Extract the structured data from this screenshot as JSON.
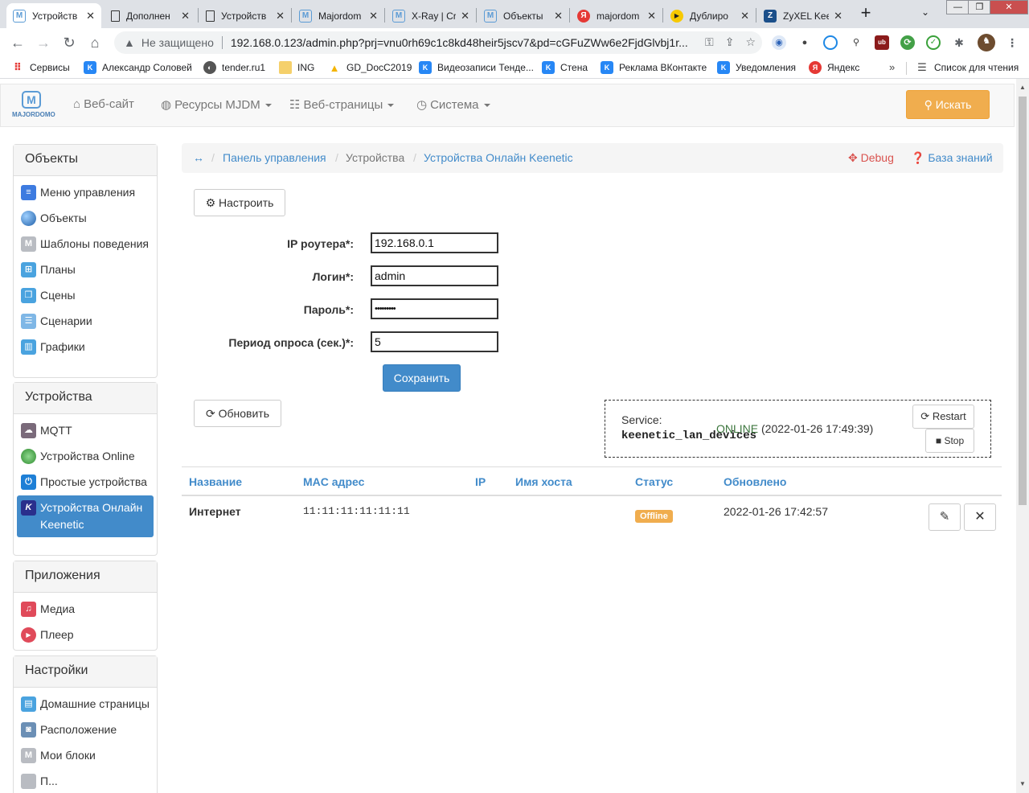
{
  "browser": {
    "tabs": [
      {
        "title": "Устройств",
        "icon": "majordomo-favicon",
        "active": true
      },
      {
        "title": "Дополнен",
        "icon": "page-favicon"
      },
      {
        "title": "Устройств",
        "icon": "page-favicon"
      },
      {
        "title": "Majordom",
        "icon": "majordomo-favicon"
      },
      {
        "title": "X-Ray | Cr",
        "icon": "majordomo-favicon"
      },
      {
        "title": "Объекты",
        "icon": "majordomo-favicon"
      },
      {
        "title": "majordom",
        "icon": "yandex-favicon"
      },
      {
        "title": "Дублиро",
        "icon": "play-favicon"
      },
      {
        "title": "ZyXEL Kee",
        "icon": "zyxel-favicon"
      }
    ],
    "address": {
      "security_label": "Не защищено",
      "url": "192.168.0.123/admin.php?prj=vnu0rh69c1c8kd48heir5jscv7&pd=cGFuZWw6e2FjdGlvbj1r..."
    },
    "bookmarks": [
      {
        "label": "Сервисы",
        "icon": "apps-icon"
      },
      {
        "label": "Александр Соловей",
        "icon": "vk-icon"
      },
      {
        "label": "tender.ru1",
        "icon": "globe-icon"
      },
      {
        "label": "ING",
        "icon": "folder-icon"
      },
      {
        "label": "GD_DocC2019",
        "icon": "drive-icon"
      },
      {
        "label": "Видеозаписи Тенде...",
        "icon": "vk-icon"
      },
      {
        "label": "Стена",
        "icon": "vk-icon"
      },
      {
        "label": "Реклама ВКонтакте",
        "icon": "vk-icon"
      },
      {
        "label": "Уведомления",
        "icon": "vk-icon"
      },
      {
        "label": "Яндекс",
        "icon": "yandex-icon"
      }
    ],
    "bookmarks_more": "»",
    "reading_list": "Список для чтения"
  },
  "topnav": {
    "logo_text": "MAJORDOMO",
    "items": [
      {
        "label": "Веб-сайт",
        "icon": "home-icon"
      },
      {
        "label": "Ресурсы MJDM",
        "icon": "globe-icon"
      },
      {
        "label": "Веб-страницы",
        "icon": "list-icon"
      },
      {
        "label": "Система",
        "icon": "dashboard-icon"
      }
    ],
    "search_label": "Искать"
  },
  "sidebar": {
    "panels": [
      {
        "title": "Объекты",
        "items": [
          {
            "label": "Меню управления",
            "icon": "menu-icon",
            "color": "#3d7be0"
          },
          {
            "label": "Объекты",
            "icon": "sphere-icon",
            "color": "#2c6fb8"
          },
          {
            "label": "Шаблоны поведения",
            "icon": "template-icon",
            "color": "#b9bcc2"
          },
          {
            "label": "Планы",
            "icon": "plan-icon",
            "color": "#4aa3df"
          },
          {
            "label": "Сцены",
            "icon": "scenes-icon",
            "color": "#4aa3df"
          },
          {
            "label": "Сценарии",
            "icon": "scripts-icon",
            "color": "#7fb7e6"
          },
          {
            "label": "Графики",
            "icon": "chart-icon",
            "color": "#4aa3df"
          }
        ]
      },
      {
        "title": "Устройства",
        "items": [
          {
            "label": "MQTT",
            "icon": "cloud-icon",
            "color": "#7a6a7a"
          },
          {
            "label": "Устройства Online",
            "icon": "online-icon",
            "color": "#3aa13a"
          },
          {
            "label": "Простые устройства",
            "icon": "power-icon",
            "color": "#1e7fd6"
          },
          {
            "label": "Устройства Онлайн Keenetic",
            "icon": "keenetic-icon",
            "color": "#2a2f8c",
            "active": true
          }
        ]
      },
      {
        "title": "Приложения",
        "items": [
          {
            "label": "Медиа",
            "icon": "music-icon",
            "color": "#e04a5a"
          },
          {
            "label": "Плеер",
            "icon": "play-icon",
            "color": "#e04a5a"
          }
        ]
      },
      {
        "title": "Настройки",
        "items": [
          {
            "label": "Домашние страницы",
            "icon": "document-icon",
            "color": "#4aa3df"
          },
          {
            "label": "Расположение",
            "icon": "camera-icon",
            "color": "#6b8fb5"
          },
          {
            "label": "Мои блоки",
            "icon": "blocks-icon",
            "color": "#b9bcc2"
          },
          {
            "label": "П...",
            "icon": "generic-icon",
            "color": "#b9bcc2"
          }
        ]
      }
    ]
  },
  "breadcrumb": {
    "toggle": "↔",
    "items": [
      "Панель управления",
      "Устройства",
      "Устройства Онлайн Keenetic"
    ],
    "separator": "/",
    "debug_label": "Debug",
    "kb_label": "База знаний"
  },
  "form": {
    "configure_label": "Настроить",
    "fields": [
      {
        "label": "IP роутера*:",
        "value": "192.168.0.1"
      },
      {
        "label": "Логин*:",
        "value": "admin"
      },
      {
        "label": "Пароль*:",
        "value": "•••••••••"
      },
      {
        "label": "Период опроса (сек.)*:",
        "value": "5"
      }
    ],
    "save_label": "Сохранить"
  },
  "refresh_label": "Обновить",
  "service": {
    "label": "Service:",
    "name": "keenetic_lan_devices",
    "status": "ONLINE",
    "timestamp": "(2022-01-26 17:49:39)",
    "restart_label": "Restart",
    "stop_label": "Stop"
  },
  "table": {
    "headers": [
      "Название",
      "MAC адрес",
      "IP",
      "Имя хоста",
      "Статус",
      "Обновлено"
    ],
    "rows": [
      {
        "name": "Интернет",
        "mac": "11:11:11:11:11:11",
        "ip": "",
        "host": "",
        "status": "Offline",
        "updated": "2022-01-26 17:42:57"
      }
    ]
  },
  "colors": {
    "primary": "#428bca",
    "warning": "#f0ad4e",
    "danger": "#d9534f",
    "success": "#3c763d"
  }
}
